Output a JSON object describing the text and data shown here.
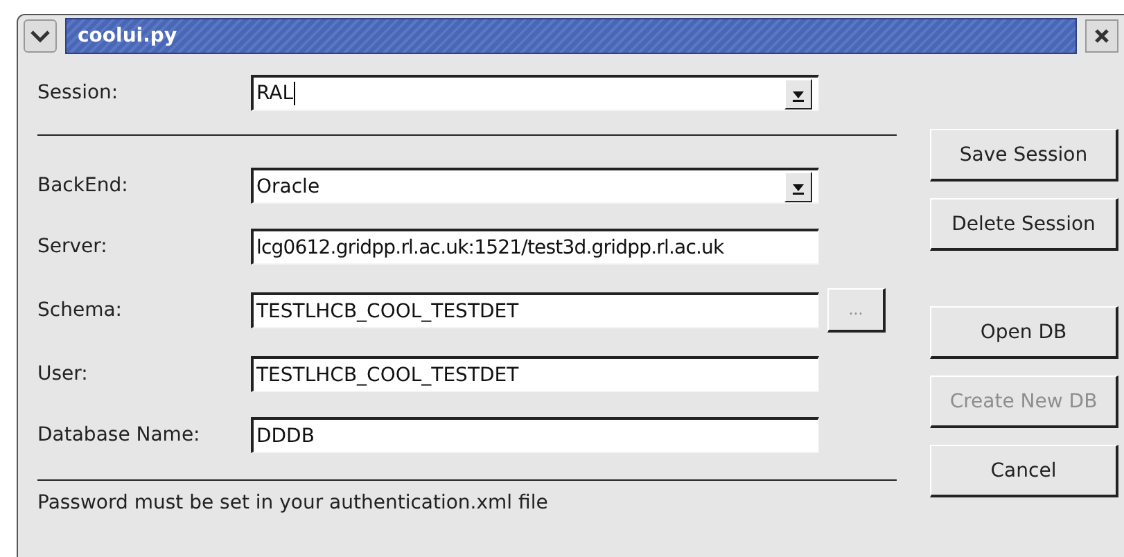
{
  "window": {
    "title": "coolui.py"
  },
  "session": {
    "label": "Session:",
    "value": "RAL",
    "kind": "combo"
  },
  "fields": [
    {
      "label": "BackEnd:",
      "value": "Oracle",
      "kind": "select"
    },
    {
      "label": "Server:",
      "value": "lcg0612.gridpp.rl.ac.uk:1521/test3d.gridpp.rl.ac.uk",
      "kind": "text"
    },
    {
      "label": "Schema:",
      "value": "TESTLHCB_COOL_TESTDET",
      "kind": "text",
      "browse": {
        "label": "...",
        "disabled": true
      }
    },
    {
      "label": "User:",
      "value": "TESTLHCB_COOL_TESTDET",
      "kind": "text"
    },
    {
      "label": "Database Name:",
      "value": "DDDB",
      "kind": "text"
    }
  ],
  "session_buttons": [
    {
      "label": "Save Session",
      "disabled": false
    },
    {
      "label": "Delete Session",
      "disabled": false
    }
  ],
  "db_buttons": [
    {
      "label": "Open DB",
      "disabled": false
    },
    {
      "label": "Create New DB",
      "disabled": true
    },
    {
      "label": "Cancel",
      "disabled": false
    }
  ],
  "status_bar": "Password must be set in your authentication.xml file"
}
